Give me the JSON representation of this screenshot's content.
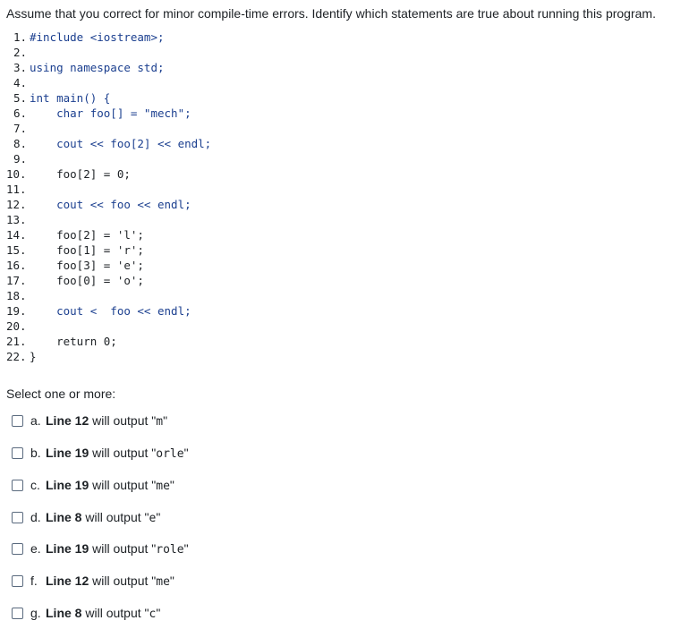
{
  "question": "Assume that you correct for minor compile-time errors. Identify which statements are true about running this program.",
  "code_lines": [
    {
      "n": "1.",
      "code": "#include <iostream>;"
    },
    {
      "n": "2.",
      "code": ""
    },
    {
      "n": "3.",
      "code": "using namespace std;"
    },
    {
      "n": "4.",
      "code": ""
    },
    {
      "n": "5.",
      "code": "int main() {"
    },
    {
      "n": "6.",
      "code": "    char foo[] = \"mech\";"
    },
    {
      "n": "7.",
      "code": ""
    },
    {
      "n": "8.",
      "code": "    cout << foo[2] << endl;"
    },
    {
      "n": "9.",
      "code": ""
    },
    {
      "n": "10.",
      "code": "    foo[2] = 0;"
    },
    {
      "n": "11.",
      "code": ""
    },
    {
      "n": "12.",
      "code": "    cout << foo << endl;"
    },
    {
      "n": "13.",
      "code": ""
    },
    {
      "n": "14.",
      "code": "    foo[2] = 'l';"
    },
    {
      "n": "15.",
      "code": "    foo[1] = 'r';"
    },
    {
      "n": "16.",
      "code": "    foo[3] = 'e';"
    },
    {
      "n": "17.",
      "code": "    foo[0] = 'o';"
    },
    {
      "n": "18.",
      "code": ""
    },
    {
      "n": "19.",
      "code": "    cout <  foo << endl;"
    },
    {
      "n": "20.",
      "code": ""
    },
    {
      "n": "21.",
      "code": "    return 0;"
    },
    {
      "n": "22.",
      "code": "}"
    }
  ],
  "prompt": "Select one or more:",
  "options": [
    {
      "letter": "a.",
      "line": "Line 12",
      "mid": " will output \"",
      "value": "m",
      "end": "\""
    },
    {
      "letter": "b.",
      "line": "Line 19",
      "mid": " will output \"",
      "value": "orle",
      "end": "\""
    },
    {
      "letter": "c.",
      "line": "Line 19",
      "mid": " will output \"",
      "value": "me",
      "end": "\""
    },
    {
      "letter": "d.",
      "line": "Line 8",
      "mid": " will output \"",
      "value": "e",
      "end": "\""
    },
    {
      "letter": "e.",
      "line": "Line 19",
      "mid": " will output \"",
      "value": "role",
      "end": "\""
    },
    {
      "letter": "f.",
      "line": "Line 12",
      "mid": " will output \"",
      "value": "me",
      "end": "\""
    },
    {
      "letter": "g.",
      "line": "Line 8",
      "mid": " will output \"",
      "value": "c",
      "end": "\""
    }
  ]
}
